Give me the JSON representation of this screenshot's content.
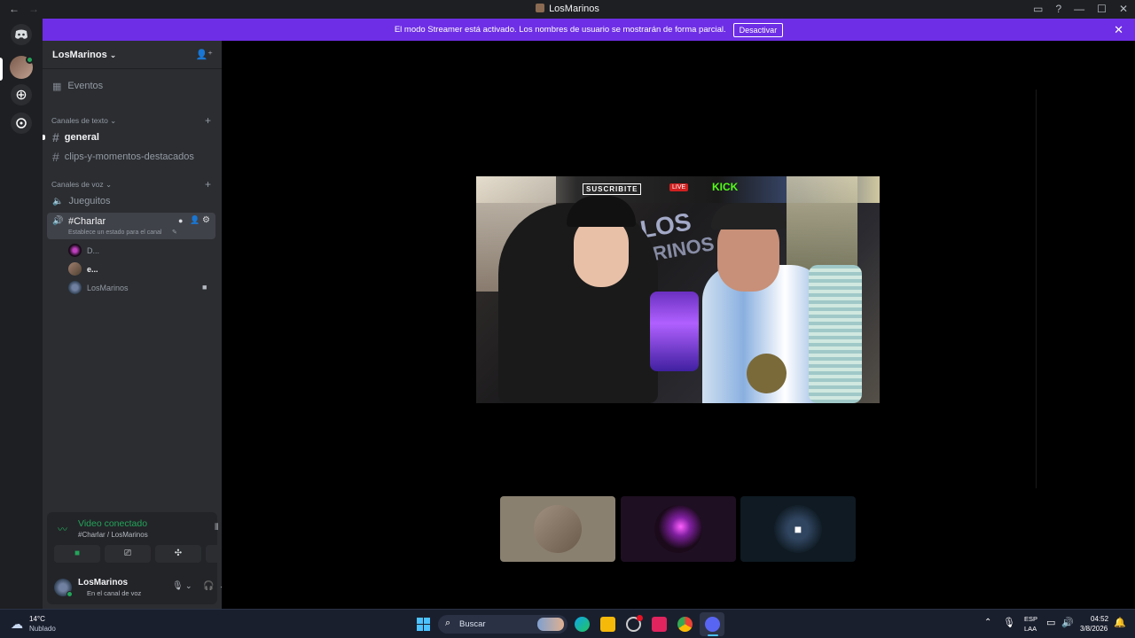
{
  "window": {
    "title": "LosMarinos"
  },
  "banner": {
    "text": "El modo Streamer está activado. Los nombres de usuario se mostrarán de forma parcial.",
    "button": "Desactivar"
  },
  "server": {
    "name": "LosMarinos"
  },
  "events": {
    "label": "Eventos"
  },
  "text_category": {
    "label": "Canales de texto"
  },
  "text_channels": [
    {
      "name": "general"
    },
    {
      "name": "clips-y-momentos-destacados"
    }
  ],
  "voice_category": {
    "label": "Canales de voz"
  },
  "voice_channels": [
    {
      "name": "Jueguitos"
    },
    {
      "name": "#Charlar",
      "status_hint": "Establece un estado para el canal"
    }
  ],
  "voice_users": [
    {
      "name": "D..."
    },
    {
      "name": "e..."
    },
    {
      "name": "LosMarinos"
    }
  ],
  "connection": {
    "status": "Video conectado",
    "channel": "#Charlar / LosMarinos"
  },
  "user": {
    "name": "LosMarinos",
    "status": "En el canal de voz"
  },
  "stream_overlay": {
    "text_los": "LOS",
    "text_marinos": "MARINOS",
    "kick": "KICK",
    "live": "LIVE",
    "suscribite": "SUSCRIBITE"
  },
  "taskbar": {
    "weather_temp": "14°C",
    "weather_desc": "Nublado",
    "search": "Buscar",
    "lang_1": "ESP",
    "lang_2": "LAA",
    "time": "04:52",
    "date": "3/8/2026"
  },
  "colors": {
    "accent": "#6e2ee5",
    "green": "#23a55a",
    "sidebar": "#2b2d31",
    "guild_bar": "#1e1f22"
  }
}
